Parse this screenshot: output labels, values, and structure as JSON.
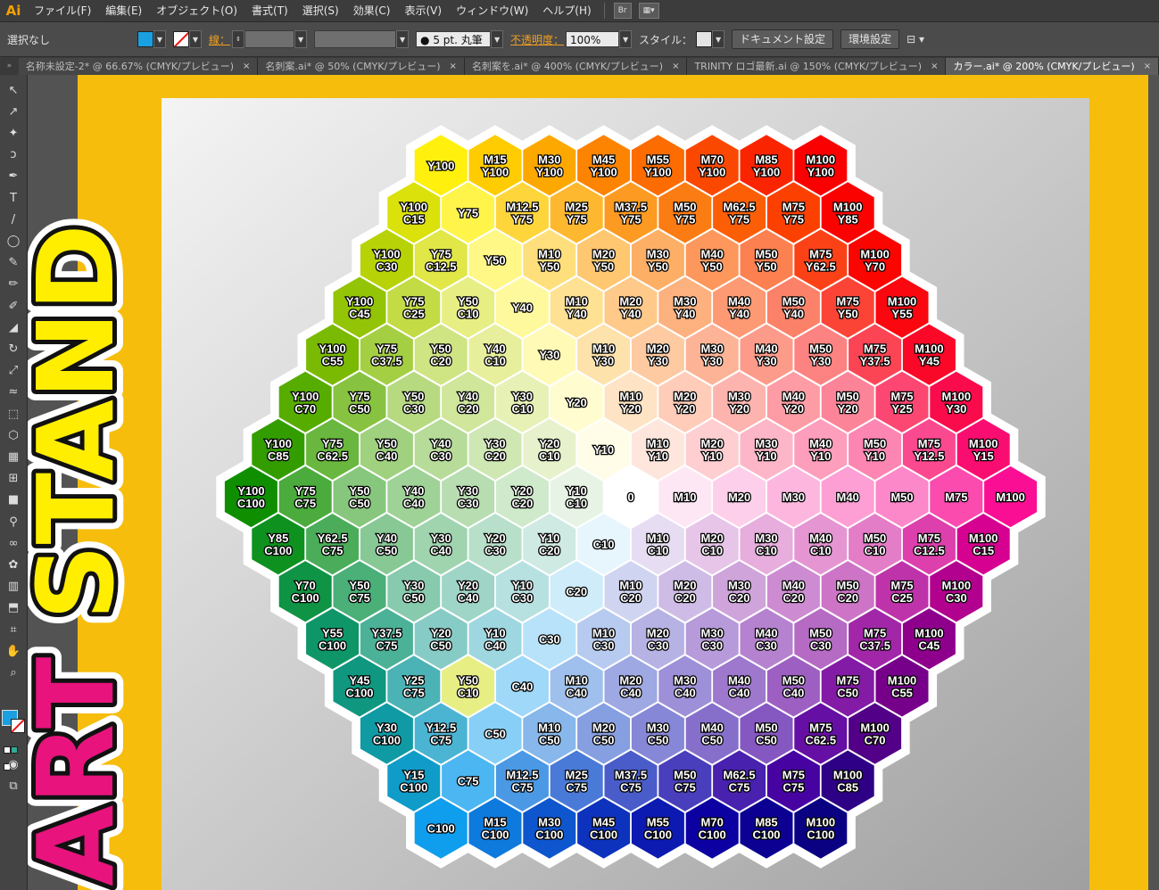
{
  "app": {
    "logo": "Ai"
  },
  "menu": [
    "ファイル(F)",
    "編集(E)",
    "オブジェクト(O)",
    "書式(T)",
    "選択(S)",
    "効果(C)",
    "表示(V)",
    "ウィンドウ(W)",
    "ヘルプ(H)"
  ],
  "menu_br": "Br",
  "control": {
    "selection": "選択なし",
    "stroke_label": "線：",
    "brush": "5 pt. 丸筆",
    "opacity_label": "不透明度：",
    "opacity": "100%",
    "style_label": "スタイル：",
    "doc_settings": "ドキュメント設定",
    "prefs": "環境設定"
  },
  "tabs": [
    {
      "label": "名称未設定-2* @ 66.67% (CMYK/プレビュー)",
      "active": false
    },
    {
      "label": "名刺案.ai* @ 50% (CMYK/プレビュー)",
      "active": false
    },
    {
      "label": "名刺案を.ai* @ 400% (CMYK/プレビュー)",
      "active": false
    },
    {
      "label": "TRINITY ロゴ最新.ai @ 150% (CMYK/プレビュー)",
      "active": false
    },
    {
      "label": "カラー.ai* @ 200% (CMYK/プレビュー)",
      "active": true
    }
  ],
  "tools": [
    "selection-tool",
    "direct-selection-tool",
    "magic-wand-tool",
    "lasso-tool",
    "pen-tool",
    "type-tool",
    "line-tool",
    "ellipse-tool",
    "paintbrush-tool",
    "pencil-tool",
    "blob-brush-tool",
    "eraser-tool",
    "rotate-tool",
    "scale-tool",
    "warp-tool",
    "free-transform-tool",
    "shape-builder-tool",
    "graph-tool",
    "mesh-tool",
    "gradient-tool",
    "eyedropper-tool",
    "blend-tool",
    "symbol-sprayer-tool",
    "column-graph-tool",
    "artboard-tool",
    "slice-tool",
    "hand-tool",
    "zoom-tool"
  ],
  "tool_glyphs": [
    "↖",
    "↗",
    "✦",
    "ↄ",
    "✒",
    "T",
    "/",
    "◯",
    "✎",
    "✏",
    "✐",
    "◢",
    "↻",
    "⤢",
    "≈",
    "⬚",
    "⬡",
    "▦",
    "⊞",
    "■",
    "⚲",
    "∞",
    "✿",
    "▥",
    "⬒",
    "⌗",
    "✋",
    "⌕"
  ],
  "colors": {
    "fill": "#1aa0e0",
    "stroke": "none",
    "artboard_frame": "#f6bd0d",
    "logo_yellow": "#ffee00",
    "logo_magenta": "#e8137d"
  },
  "logo_text": "ART STAND",
  "hexrows": [
    [
      "Y100",
      "M15\nY100",
      "M30\nY100",
      "M45\nY100",
      "M55\nY100",
      "M70\nY100",
      "M85\nY100",
      "M100\nY100"
    ],
    [
      "Y100\nC15",
      "Y75",
      "M12.5\nY75",
      "M25\nY75",
      "M37.5\nY75",
      "M50\nY75",
      "M62.5\nY75",
      "M75\nY75",
      "M100\nY85"
    ],
    [
      "Y100\nC30",
      "Y75\nC12.5",
      "Y50",
      "M10\nY50",
      "M20\nY50",
      "M30\nY50",
      "M40\nY50",
      "M50\nY50",
      "M75\nY62.5",
      "M100\nY70"
    ],
    [
      "Y100\nC45",
      "Y75\nC25",
      "Y50\nC10",
      "Y40",
      "M10\nY40",
      "M20\nY40",
      "M30\nY40",
      "M40\nY40",
      "M50\nY40",
      "M75\nY50",
      "M100\nY55"
    ],
    [
      "Y100\nC55",
      "Y75\nC37.5",
      "Y50\nC20",
      "Y40\nC10",
      "Y30",
      "M10\nY30",
      "M20\nY30",
      "M30\nY30",
      "M40\nY30",
      "M50\nY30",
      "M75\nY37.5",
      "M100\nY45"
    ],
    [
      "Y100\nC70",
      "Y75\nC50",
      "Y50\nC30",
      "Y40\nC20",
      "Y30\nC10",
      "Y20",
      "M10\nY20",
      "M20\nY20",
      "M30\nY20",
      "M40\nY20",
      "M50\nY20",
      "M75\nY25",
      "M100\nY30"
    ],
    [
      "Y100\nC85",
      "Y75\nC62.5",
      "Y50\nC40",
      "Y40\nC30",
      "Y30\nC20",
      "Y20\nC10",
      "Y10",
      "M10\nY10",
      "M20\nY10",
      "M30\nY10",
      "M40\nY10",
      "M50\nY10",
      "M75\nY12.5",
      "M100\nY15"
    ],
    [
      "Y100\nC100",
      "Y75\nC75",
      "Y50\nC50",
      "Y40\nC40",
      "Y30\nC30",
      "Y20\nC20",
      "Y10\nC10",
      "0",
      "M10",
      "M20",
      "M30",
      "M40",
      "M50",
      "M75",
      "M100"
    ],
    [
      "Y85\nC100",
      "Y62.5\nC75",
      "Y40\nC50",
      "Y30\nC40",
      "Y20\nC30",
      "Y10\nC20",
      "C10",
      "M10\nC10",
      "M20\nC10",
      "M30\nC10",
      "M40\nC10",
      "M50\nC10",
      "M75\nC12.5",
      "M100\nC15"
    ],
    [
      "Y70\nC100",
      "Y50\nC75",
      "Y30\nC50",
      "Y20\nC40",
      "Y10\nC30",
      "C20",
      "M10\nC20",
      "M20\nC20",
      "M30\nC20",
      "M40\nC20",
      "M50\nC20",
      "M75\nC25",
      "M100\nC30"
    ],
    [
      "Y55\nC100",
      "Y37.5\nC75",
      "Y20\nC50",
      "Y10\nC40",
      "C30",
      "M10\nC30",
      "M20\nC30",
      "M30\nC30",
      "M40\nC30",
      "M50\nC30",
      "M75\nC37.5",
      "M100\nC45"
    ],
    [
      "Y45\nC100",
      "Y25\nC75",
      "Y50\nC10",
      "C40",
      "M10\nC40",
      "M20\nC40",
      "M30\nC40",
      "M40\nC40",
      "M50\nC40",
      "M75\nC50",
      "M100\nC55"
    ],
    [
      "Y30\nC100",
      "Y12.5\nC75",
      "C50",
      "M10\nC50",
      "M20\nC50",
      "M30\nC50",
      "M40\nC50",
      "M50\nC50",
      "M75\nC62.5",
      "M100\nC70"
    ],
    [
      "Y15\nC100",
      "C75",
      "M12.5\nC75",
      "M25\nC75",
      "M37.5\nC75",
      "M50\nC75",
      "M62.5\nC75",
      "M75\nC75",
      "M100\nC85"
    ],
    [
      "C100",
      "M15\nC100",
      "M30\nC100",
      "M45\nC100",
      "M55\nC100",
      "M70\nC100",
      "M85\nC100",
      "M100\nC100"
    ]
  ]
}
